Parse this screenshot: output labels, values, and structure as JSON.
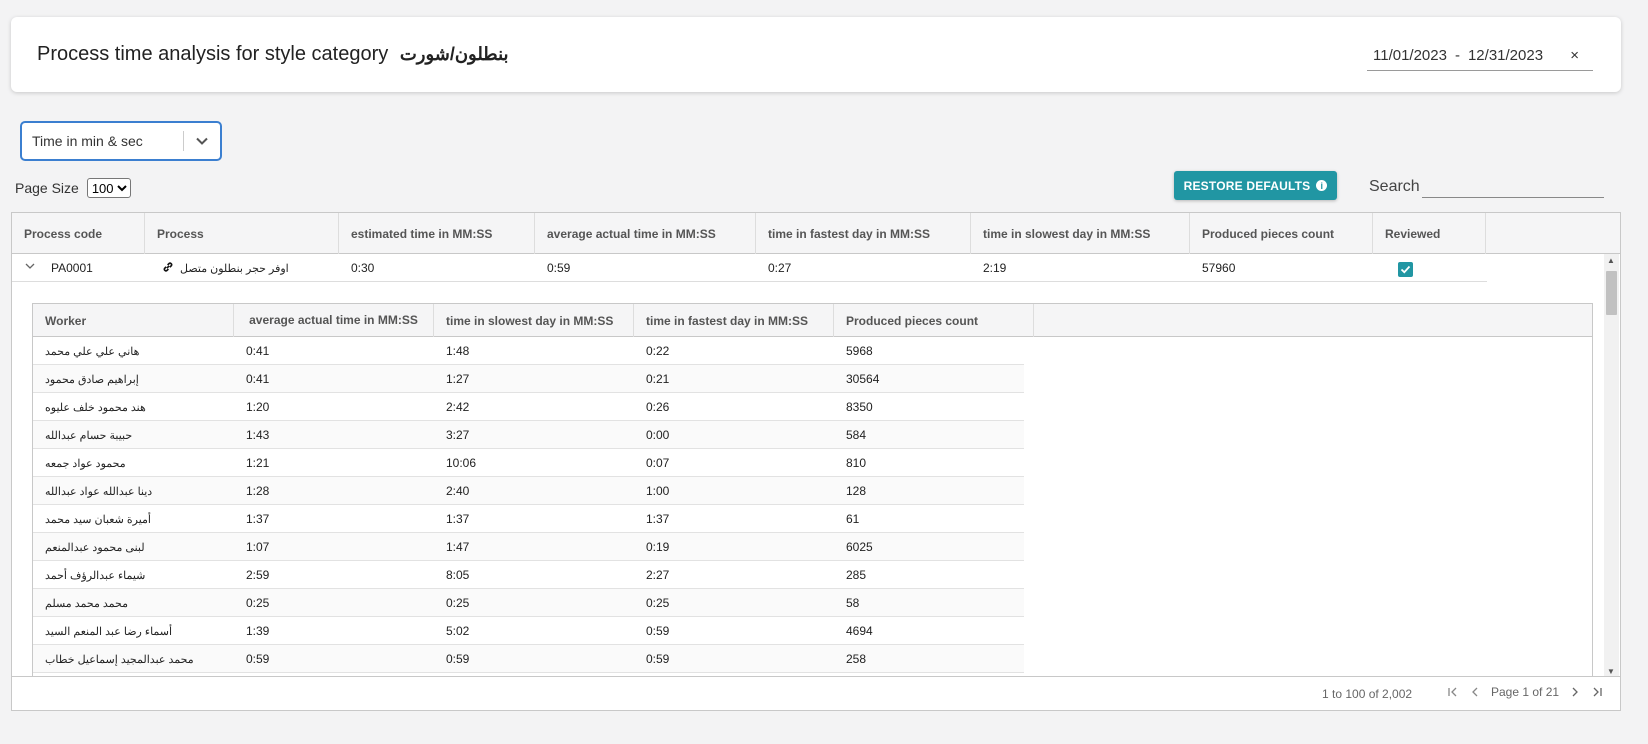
{
  "header": {
    "title": "Process time analysis for style category",
    "category": "بنطلون/شورت",
    "date_from": "11/01/2023",
    "date_sep": "-",
    "date_to": "12/31/2023",
    "clear_symbol": "×"
  },
  "unit_select": {
    "value": "Time in min & sec"
  },
  "page_size": {
    "label": "Page Size",
    "value": "100"
  },
  "toolbar": {
    "restore_label": "RESTORE DEFAULTS",
    "info_glyph": "i",
    "search_label": "Search",
    "search_value": ""
  },
  "grid": {
    "columns": [
      "Process code",
      "Process",
      "estimated time in MM:SS",
      "average actual time in MM:SS",
      "time in fastest day in MM:SS",
      "time in slowest day in MM:SS",
      "Produced pieces count",
      "Reviewed"
    ],
    "row": {
      "code": "PA0001",
      "process": "اوفر حجر بنطلون متصل",
      "estimated": "0:30",
      "average": "0:59",
      "fastest": "0:27",
      "slowest": "2:19",
      "pieces": "57960",
      "reviewed": true
    }
  },
  "detail": {
    "columns": [
      "Worker",
      "average actual time in MM:SS",
      "time in slowest day in MM:SS",
      "time in fastest day in MM:SS",
      "Produced pieces count"
    ],
    "rows": [
      {
        "worker": "هاني علي علي محمد",
        "average": "0:41",
        "slowest": "1:48",
        "fastest": "0:22",
        "pieces": "5968"
      },
      {
        "worker": "إبراهيم صادق محمود",
        "average": "0:41",
        "slowest": "1:27",
        "fastest": "0:21",
        "pieces": "30564"
      },
      {
        "worker": "هند محمود خلف عليوه",
        "average": "1:20",
        "slowest": "2:42",
        "fastest": "0:26",
        "pieces": "8350"
      },
      {
        "worker": "حبيبة حسام عبدالله",
        "average": "1:43",
        "slowest": "3:27",
        "fastest": "0:00",
        "pieces": "584"
      },
      {
        "worker": "محمود عواد جمعه",
        "average": "1:21",
        "slowest": "10:06",
        "fastest": "0:07",
        "pieces": "810"
      },
      {
        "worker": "دينا عبدالله عواد عبدالله",
        "average": "1:28",
        "slowest": "2:40",
        "fastest": "1:00",
        "pieces": "128"
      },
      {
        "worker": "أميرة شعبان سيد محمد",
        "average": "1:37",
        "slowest": "1:37",
        "fastest": "1:37",
        "pieces": "61"
      },
      {
        "worker": "لبنى محمود عبدالمنعم",
        "average": "1:07",
        "slowest": "1:47",
        "fastest": "0:19",
        "pieces": "6025"
      },
      {
        "worker": "شيماء عبدالرؤف أحمد",
        "average": "2:59",
        "slowest": "8:05",
        "fastest": "2:27",
        "pieces": "285"
      },
      {
        "worker": "محمد محمد مسلم",
        "average": "0:25",
        "slowest": "0:25",
        "fastest": "0:25",
        "pieces": "58"
      },
      {
        "worker": "أسماء رضا عبد المنعم السيد",
        "average": "1:39",
        "slowest": "5:02",
        "fastest": "0:59",
        "pieces": "4694"
      },
      {
        "worker": "محمد عبدالمجيد إسماعيل خطاب",
        "average": "0:59",
        "slowest": "0:59",
        "fastest": "0:59",
        "pieces": "258"
      }
    ]
  },
  "footer": {
    "summary": "1 to 100 of 2,002",
    "page_text": "Page 1 of 21"
  },
  "colors": {
    "accent": "#2196a3",
    "select_border": "#3b7fd0"
  }
}
